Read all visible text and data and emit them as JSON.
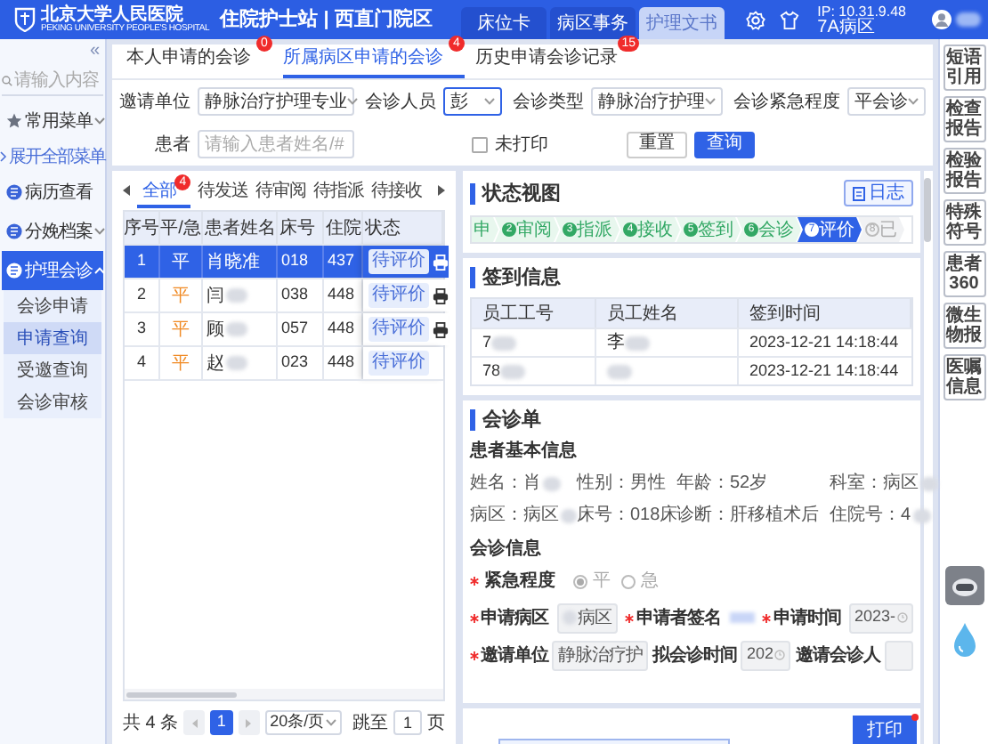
{
  "header": {
    "hospital_name": "北京大学人民医院",
    "hospital_name_en": "PEKING UNIVERSITY PEOPLE'S HOSPITAL",
    "title": "住院护士站 | 西直门院区",
    "tabs": [
      {
        "label": "床位卡",
        "selected": false
      },
      {
        "label": "病区事务",
        "selected": false
      },
      {
        "label": "护理文书",
        "selected": true
      }
    ],
    "ip": "IP: 10.31.9.48",
    "ward": "7A病区"
  },
  "sidebar": {
    "collapse": "«",
    "search": {
      "placeholder": "请输入内容"
    },
    "items": [
      {
        "kind": "group",
        "label": "常用菜单",
        "expanded": false,
        "selected": false
      },
      {
        "kind": "link",
        "label": "展开全部菜单"
      },
      {
        "kind": "item",
        "label": "病历查看",
        "selected": false
      },
      {
        "kind": "group",
        "label": "分娩档案",
        "expanded": false,
        "selected": false
      },
      {
        "kind": "group",
        "label": "护理会诊",
        "expanded": true,
        "selected": true,
        "children": [
          {
            "label": "会诊申请",
            "selected": false
          },
          {
            "label": "申请查询",
            "selected": true
          },
          {
            "label": "受邀查询",
            "selected": false
          },
          {
            "label": "会诊审核",
            "selected": false
          }
        ]
      }
    ]
  },
  "tabs": [
    {
      "label": "本人申请的会诊",
      "badge": "0",
      "selected": false
    },
    {
      "label": "所属病区申请的会诊",
      "badge": "4",
      "selected": true
    },
    {
      "label": "历史申请会诊记录",
      "badge": "15",
      "selected": false
    }
  ],
  "filters": [
    {
      "kind": "select",
      "label": "邀请单位",
      "value": "静脉治疗护理专业",
      "focused": false
    },
    {
      "kind": "select",
      "label": "会诊人员",
      "value": "彭",
      "focused": true
    },
    {
      "kind": "select",
      "label": "会诊类型",
      "value": "静脉治疗护理",
      "focused": false
    },
    {
      "kind": "select",
      "label": "会诊紧急程度",
      "value": "平会诊",
      "focused": false
    },
    {
      "kind": "input",
      "label": "患者",
      "placeholder": "请输入患者姓名/#"
    },
    {
      "kind": "checkbox",
      "label": "未打印",
      "checked": false
    }
  ],
  "buttons": [
    {
      "label": "重置",
      "primary": false
    },
    {
      "label": "查询",
      "primary": true
    }
  ],
  "list": {
    "status_tabs": [
      {
        "label": "全部",
        "badge": "4",
        "selected": true
      },
      {
        "label": "待发送",
        "selected": false
      },
      {
        "label": "待审阅",
        "selected": false
      },
      {
        "label": "待指派",
        "selected": false
      },
      {
        "label": "待接收",
        "selected": false
      }
    ],
    "columns": [
      "序号",
      "平/急",
      "患者姓名",
      "床号",
      "住院",
      "状态"
    ],
    "rows": [
      {
        "no": "1",
        "urgency": "平",
        "name": "肖晓准",
        "bed": "018",
        "admission": "437",
        "status": "待评价",
        "printable": true,
        "selected": true
      },
      {
        "no": "2",
        "urgency": "平",
        "name": "闫",
        "bed": "038",
        "admission": "448",
        "status": "待评价",
        "printable": true,
        "selected": false
      },
      {
        "no": "3",
        "urgency": "平",
        "name": "顾",
        "bed": "057",
        "admission": "448",
        "status": "待评价",
        "printable": true,
        "selected": false
      },
      {
        "no": "4",
        "urgency": "平",
        "name": "赵",
        "bed": "023",
        "admission": "448",
        "status": "待评价",
        "printable": false,
        "selected": false
      }
    ],
    "pagination": {
      "total": "共 4 条",
      "page": "1",
      "page_size": "20条/页",
      "goto_label": "跳至",
      "goto_value": "1",
      "page_suffix": "页"
    }
  },
  "status_view": {
    "title": "状态视图",
    "log_button": "日志",
    "steps": [
      {
        "label": "申",
        "done": true,
        "selected": false
      },
      {
        "number": "2",
        "label": "审阅",
        "done": true,
        "selected": false
      },
      {
        "number": "3",
        "label": "指派",
        "done": true,
        "selected": false
      },
      {
        "number": "4",
        "label": "接收",
        "done": true,
        "selected": false
      },
      {
        "number": "5",
        "label": "签到",
        "done": true,
        "selected": false
      },
      {
        "number": "6",
        "label": "会诊",
        "done": true,
        "selected": false
      },
      {
        "number": "7",
        "label": "评价",
        "done": false,
        "selected": true
      },
      {
        "number": "8",
        "label": "已",
        "done": false,
        "selected": false
      }
    ]
  },
  "checkin": {
    "title": "签到信息",
    "columns": [
      "员工工号",
      "员工姓名",
      "签到时间"
    ],
    "rows": [
      {
        "id": "7",
        "name": "李",
        "time": "2023-12-21 14:18:44"
      },
      {
        "id": "78",
        "time": "2023-12-21 14:18:44"
      }
    ]
  },
  "form": {
    "title": "会诊单",
    "patient_heading": "患者基本信息",
    "patient_fields": [
      {
        "label": "姓名：",
        "value": "肖"
      },
      {
        "label": "性别：",
        "value": "男性"
      },
      {
        "label": "年龄：",
        "value": "52岁"
      },
      {
        "label": "科室：",
        "value": "病区"
      },
      {
        "label": "病区：",
        "value": "病区"
      },
      {
        "label": "床号：",
        "value": "018床"
      },
      {
        "label": "诊断：",
        "value": "肝移植术后"
      },
      {
        "label": "住院号：",
        "value": "4"
      }
    ],
    "consult_heading": "会诊信息",
    "urgency": {
      "label": "紧急程度",
      "required": true,
      "options": [
        {
          "label": "平",
          "selected": true
        },
        {
          "label": "急",
          "selected": false
        }
      ]
    },
    "fields": [
      {
        "kind": "text",
        "label": "申请病区",
        "required": true,
        "value": "病区"
      },
      {
        "kind": "signature",
        "label": "申请者签名",
        "required": true
      },
      {
        "kind": "date",
        "label": "申请时间",
        "required": true,
        "value": "2023-"
      },
      {
        "kind": "text",
        "label": "邀请单位",
        "required": true,
        "value": "静脉治疗护"
      },
      {
        "kind": "date",
        "label": "拟会诊时间",
        "required": false,
        "value": "202"
      },
      {
        "kind": "text",
        "label": "邀请会诊人",
        "required": false
      }
    ]
  },
  "print_button": "打印",
  "tools": [
    "短语引用",
    "检查报告",
    "检验报告",
    "特殊符号",
    "患者360",
    "微生物报",
    "医嘱信息"
  ]
}
